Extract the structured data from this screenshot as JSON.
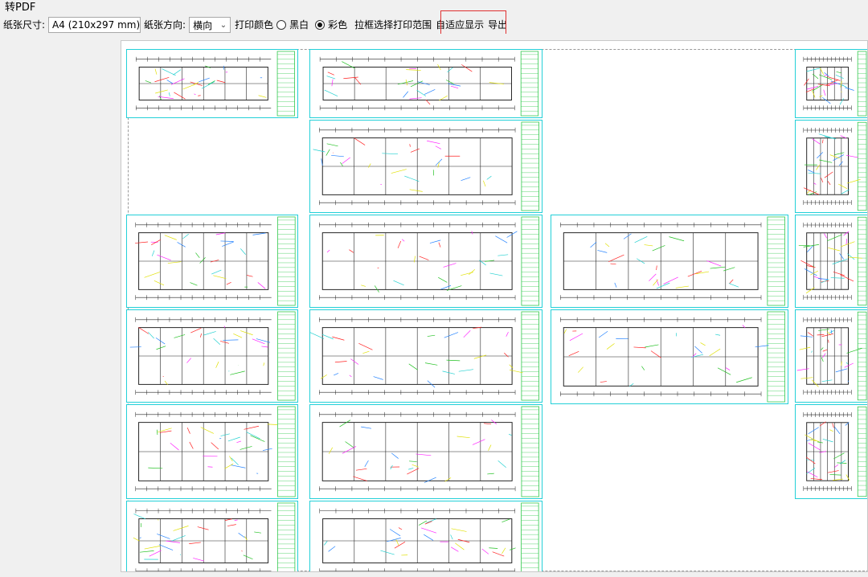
{
  "window": {
    "title": "转PDF"
  },
  "toolbar": {
    "paper_size_label": "纸张尺寸:",
    "paper_size_value": "A4 (210x297 mm)",
    "orientation_label": "纸张方向:",
    "orientation_value": "横向",
    "print_color_label": "打印颜色",
    "bw_label": "黑白",
    "color_label": "彩色",
    "color_selected": "彩色",
    "select_range_label": "拉框选择打印范围",
    "fit_display_label": "自适应显示",
    "export_label": "导出"
  },
  "colors": {
    "frame": "#23d0d8",
    "title_block": "#2ec84a",
    "wall": "#222222",
    "highlight": "#e03030",
    "print_range": "#9a9a9a"
  },
  "icons": {
    "dropdown": "chevron-down-icon",
    "north_arrow": "compass-icon"
  }
}
